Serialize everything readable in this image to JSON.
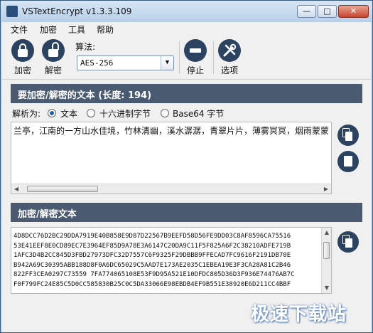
{
  "window": {
    "title": "VSTextEncrypt v1.3.3.109",
    "minimize": "—",
    "maximize": "□",
    "close": "✕"
  },
  "menu": [
    "文件",
    "加密",
    "工具",
    "帮助"
  ],
  "toolbar": {
    "encrypt_label": "加密",
    "decrypt_label": "解密",
    "algorithm_label": "算法:",
    "algorithm_value": "AES-256",
    "stop_label": "停止",
    "options_label": "选项"
  },
  "input_section": {
    "header": "要加密/解密的文本 (长度: 194)",
    "parse_as_label": "解析为:",
    "parse_options": [
      "文本",
      "十六进制字节",
      "Base64 字节"
    ],
    "selected_option": "文本",
    "text": "兰亭，江南的一方山水佳境，竹林清幽，溪水潺潺，青翠片片，薄雾冥冥，烟雨蒙蒙"
  },
  "output_section": {
    "header": "加密/解密文本",
    "lines": [
      "4D8DCC76D2BC29DDA7919E40B858E9D87D22567B9EEFD58D56FE9DD03C8AF8596CA75516",
      "53E41EEF8E0CD89EC7E3964EF85D9A78E3A6147C20DA9C11F5F825A6F2C38210ADFE719B",
      "1AFC3D4B2CC845D3FBD27973DFC32D7557C6F9325F29DBBB9FFECAD7FC9616F2191DB70E",
      "B942A69C30395ABB188D8F0A6DC65029C5AAD7E173AE2035C1EBEA19E3F3CA28A81C2B46",
      "822FF3CEA0297C73559 7FA774065108E53F9D95A521E10DFDC805D36D3F936E74476AB7C",
      "F0F799FC24E85C5D0CC585830B25C0C5DA33066E98EBDB4EF9B551E38920E6D211CC4BBF"
    ]
  },
  "watermark": "极速下载站",
  "colors": {
    "header_bg": "#4a5a70",
    "icon_bg": "#2b4260",
    "window_frame": "#c9d9ea"
  }
}
